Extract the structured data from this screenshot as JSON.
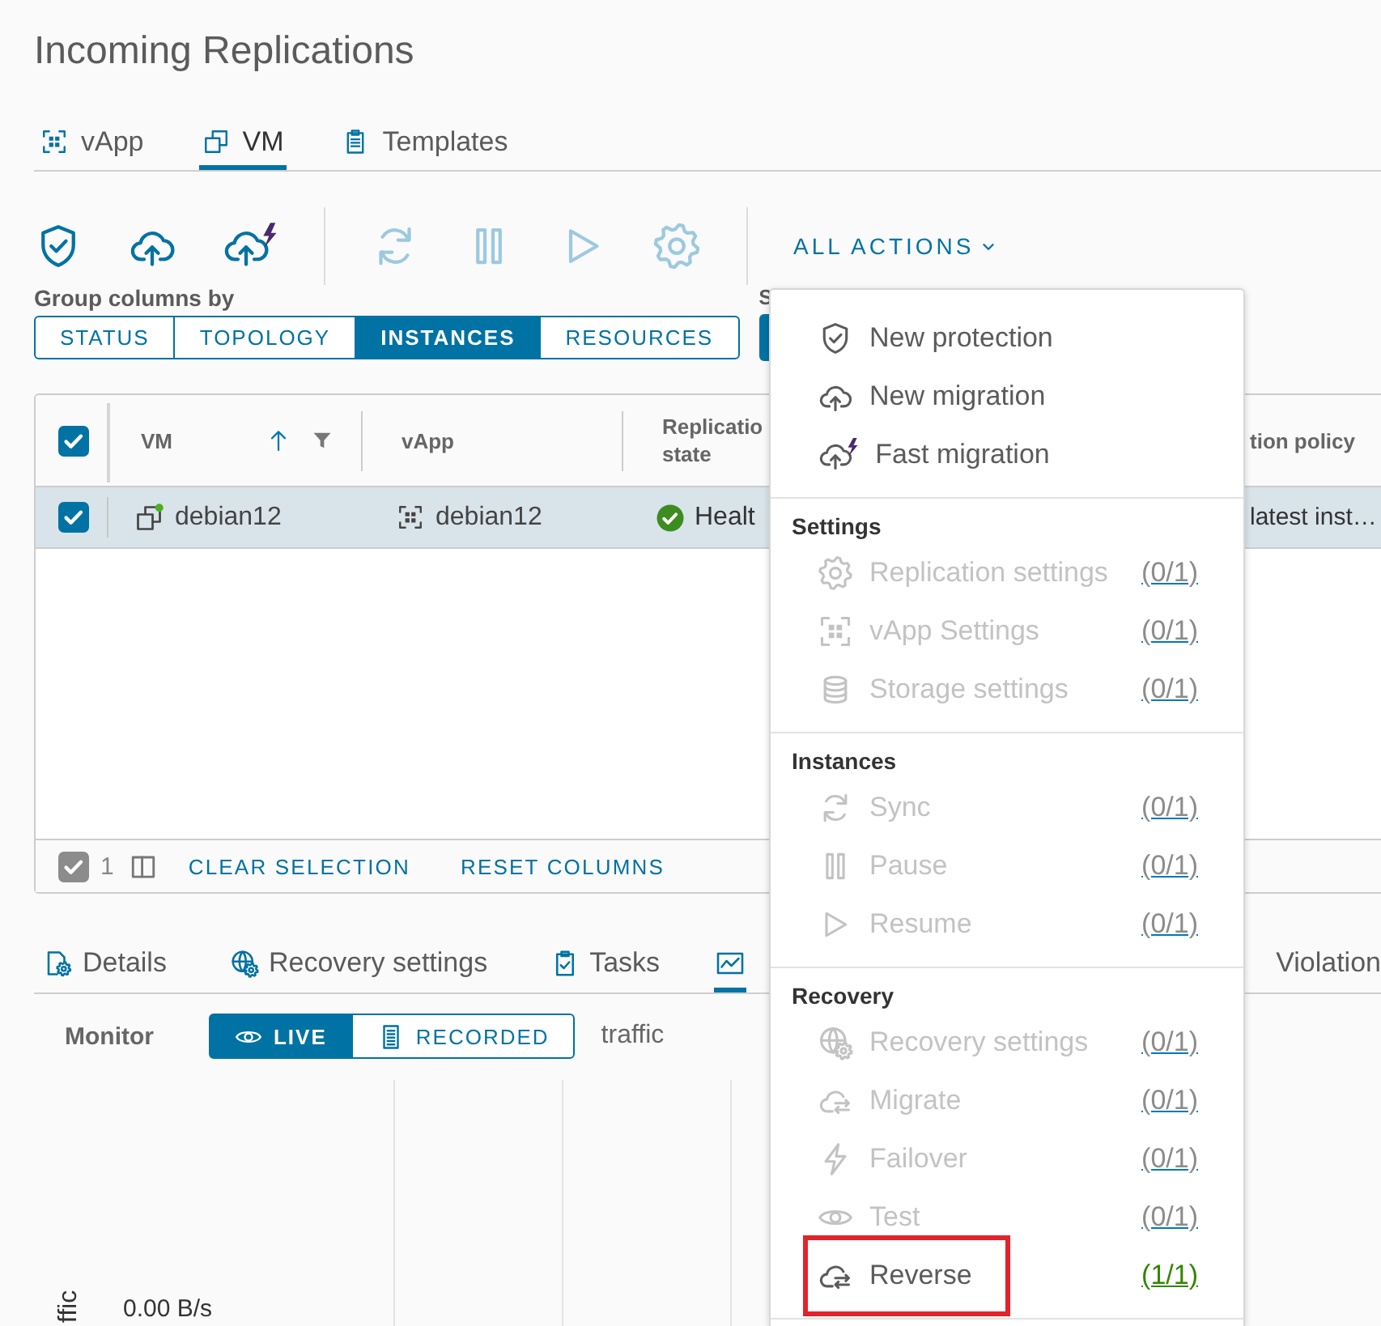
{
  "page_title": "Incoming Replications",
  "view_tabs": [
    {
      "kind": "vapp",
      "label": "vApp",
      "selected": false
    },
    {
      "kind": "vm",
      "label": "VM",
      "selected": true
    },
    {
      "kind": "template",
      "label": "Templates",
      "selected": false
    }
  ],
  "toolbar": {
    "buttons": [
      {
        "kind": "protect",
        "disabled": false
      },
      {
        "kind": "upload",
        "disabled": false
      },
      {
        "kind": "fast",
        "disabled": false
      },
      {
        "kind": "sync",
        "disabled": true
      },
      {
        "kind": "pause",
        "disabled": true
      },
      {
        "kind": "resume",
        "disabled": true
      },
      {
        "kind": "gear",
        "disabled": true
      }
    ],
    "all_actions": "ALL ACTIONS"
  },
  "group_by": {
    "label": "Group columns by",
    "options": [
      {
        "label": "STATUS",
        "selected": false
      },
      {
        "label": "TOPOLOGY",
        "selected": false
      },
      {
        "label": "INSTANCES",
        "selected": true
      },
      {
        "label": "RESOURCES",
        "selected": false
      }
    ]
  },
  "second_group": {
    "label": "S"
  },
  "table": {
    "all_selected": true,
    "columns": [
      {
        "label": "VM",
        "sorted": true,
        "filterable": true
      },
      {
        "label": "vApp",
        "sorted": false,
        "filterable": false
      },
      {
        "label": "Replicatio state",
        "sorted": false,
        "filterable": false
      },
      {
        "label": "tion policy",
        "sorted": false,
        "filterable": false
      }
    ],
    "rows": [
      {
        "selected": true,
        "vm": "debian12",
        "powered_on": true,
        "vapp": "debian12",
        "state": "Healt",
        "healthy": true,
        "policy": "latest inst…"
      }
    ],
    "footer": {
      "count": "1",
      "clear_selection": "CLEAR SELECTION",
      "reset_columns": "RESET COLUMNS"
    }
  },
  "detail_tabs": [
    {
      "kind": "details",
      "label": "Details",
      "selected": false
    },
    {
      "kind": "recovery",
      "label": "Recovery settings",
      "selected": false
    },
    {
      "kind": "tasks",
      "label": "Tasks",
      "selected": false
    },
    {
      "kind": "chart",
      "selected": true
    },
    {
      "label": "Violation",
      "selected": false
    }
  ],
  "monitor": {
    "label": "Monitor",
    "modes": [
      {
        "kind": "live",
        "label": "LIVE",
        "selected": true
      },
      {
        "kind": "recorded",
        "label": "RECORDED",
        "selected": false
      }
    ],
    "metric": "traffic"
  },
  "traffic_chart": {
    "axis_title": "ffic",
    "tick_label": "0.00 B/s"
  },
  "actions_menu": {
    "sections": [
      {
        "items": [
          {
            "kind": "protect",
            "label": "New protection",
            "disabled": false,
            "highlighted": false
          },
          {
            "kind": "upload",
            "label": "New migration",
            "disabled": false,
            "highlighted": false
          },
          {
            "kind": "fast",
            "label": "Fast migration",
            "disabled": false,
            "highlighted": false
          }
        ]
      },
      {
        "title": "Settings",
        "items": [
          {
            "kind": "gear",
            "label": "Replication settings",
            "count": "(0/1)",
            "disabled": true,
            "highlighted": false
          },
          {
            "kind": "vapp",
            "label": "vApp Settings",
            "count": "(0/1)",
            "disabled": true,
            "highlighted": false
          },
          {
            "kind": "storage",
            "label": "Storage settings",
            "count": "(0/1)",
            "disabled": true,
            "highlighted": false
          }
        ]
      },
      {
        "title": "Instances",
        "items": [
          {
            "kind": "sync",
            "label": "Sync",
            "count": "(0/1)",
            "disabled": true,
            "highlighted": false
          },
          {
            "kind": "pause",
            "label": "Pause",
            "count": "(0/1)",
            "disabled": true,
            "highlighted": false
          },
          {
            "kind": "resume",
            "label": "Resume",
            "count": "(0/1)",
            "disabled": true,
            "highlighted": false
          }
        ]
      },
      {
        "title": "Recovery",
        "items": [
          {
            "kind": "recovery",
            "label": "Recovery settings",
            "count": "(0/1)",
            "disabled": true,
            "highlighted": false
          },
          {
            "kind": "swap",
            "label": "Migrate",
            "count": "(0/1)",
            "disabled": true,
            "highlighted": false
          },
          {
            "kind": "failover",
            "label": "Failover",
            "count": "(0/1)",
            "disabled": true,
            "highlighted": false
          },
          {
            "kind": "test",
            "label": "Test",
            "count": "(0/1)",
            "disabled": true,
            "highlighted": false
          },
          {
            "kind": "swap",
            "label": "Reverse",
            "count": "(1/1)",
            "disabled": false,
            "highlighted": true
          }
        ]
      }
    ]
  }
}
